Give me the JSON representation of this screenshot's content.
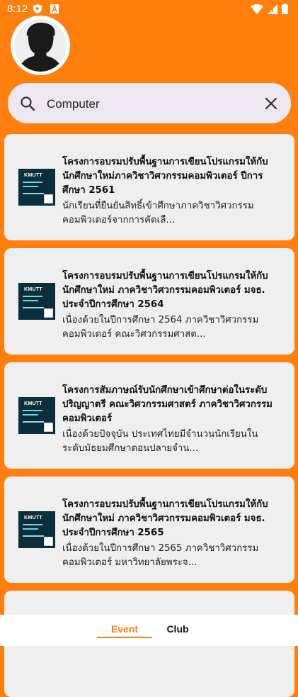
{
  "status_bar": {
    "time": "8:12"
  },
  "search": {
    "value": "Computer",
    "placeholder": ""
  },
  "thumbnail": {
    "logo_text": "KMUTT"
  },
  "cards": [
    {
      "title": "โครงการอบรมปรับพื้นฐานการเขียนโปรแกรมให้กับนักศึกษาใหม่ภาควิชาวิศวกรรมคอมพิวเตอร์ ปีการศึกษา 2561",
      "description": "นักเรียนที่ยืนยันสิทธิ์เข้าศึกษาภาควิชาวิศวกรรมคอมพิวเตอร์จากการคัดเลื..."
    },
    {
      "title": "โครงการอบรมปรับพื้นฐานการเขียนโปรแกรมให้กับนักศึกษาใหม่ ภาควิชาวิศวกรรมคอมพิวเตอร์ มจธ. ประจำปีการศึกษา 2564",
      "description": "เนื่องด้วยในปีการศึกษา 2564 ภาควิชาวิศวกรรมคอมพิวเตอร์ คณะวิศวกรรมศาสต..."
    },
    {
      "title": "โครงการสัมภาษณ์รับนักศึกษาเข้าศึกษาต่อในระดับปริญญาตรี คณะวิศวกรรมศาสตร์ ภาควิชาวิศวกรรมคอมพิวเตอร์",
      "description": "เนื่องด้วยปัจจุบัน ประเทศไทยมีจำนวนนักเรียนในระดับมัธยมศึกษาตอนปลายจำน..."
    },
    {
      "title": "โครงการอบรมปรับพื้นฐานการเขียนโปรแกรมให้กับนักศึกษาใหม่ ภาควิชาวิศวกรรมคอมพิวเตอร์ มจธ. ประจำปีการศึกษา 2565",
      "description": "เนื่องด้วยในปีการศึกษา 2565 ภาควิชาวิศวกรรมคอมพิวเตอร์ มหาวิทยาลัยพระจ..."
    },
    {
      "title": "",
      "description": ""
    }
  ],
  "bottom_nav": {
    "tabs": [
      {
        "label": "Event",
        "active": true
      },
      {
        "label": "Club",
        "active": false
      }
    ]
  },
  "colors": {
    "background": "#ff7f0e",
    "accent": "#ff7f0e",
    "card": "#efefef",
    "search_bg": "#ece7f1"
  },
  "icons": {
    "search": "search-icon",
    "clear": "close-icon",
    "avatar": "user-silhouette-icon",
    "shield": "shield-icon",
    "font_a": "font-icon",
    "wifi": "wifi-icon",
    "signal": "signal-icon",
    "battery": "battery-icon"
  }
}
